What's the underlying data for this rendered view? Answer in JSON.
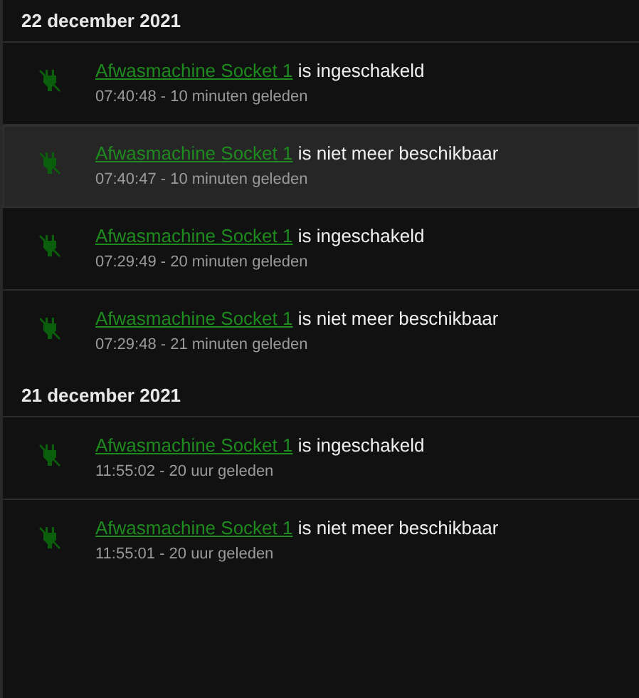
{
  "groups": [
    {
      "date": "22 december 2021",
      "events": [
        {
          "entity": "Afwasmachine Socket 1",
          "message": " is ingeschakeld",
          "time": "07:40:48 - 10 minuten geleden",
          "selected": false
        },
        {
          "entity": "Afwasmachine Socket 1",
          "message": " is niet meer beschikbaar",
          "time": "07:40:47 - 10 minuten geleden",
          "selected": true
        },
        {
          "entity": "Afwasmachine Socket 1",
          "message": " is ingeschakeld",
          "time": "07:29:49 - 20 minuten geleden",
          "selected": false
        },
        {
          "entity": "Afwasmachine Socket 1",
          "message": " is niet meer beschikbaar",
          "time": "07:29:48 - 21 minuten geleden",
          "selected": false
        }
      ]
    },
    {
      "date": "21 december 2021",
      "events": [
        {
          "entity": "Afwasmachine Socket 1",
          "message": " is ingeschakeld",
          "time": "11:55:02 - 20 uur geleden",
          "selected": false
        },
        {
          "entity": "Afwasmachine Socket 1",
          "message": " is niet meer beschikbaar",
          "time": "11:55:01 - 20 uur geleden",
          "selected": false
        }
      ]
    }
  ]
}
